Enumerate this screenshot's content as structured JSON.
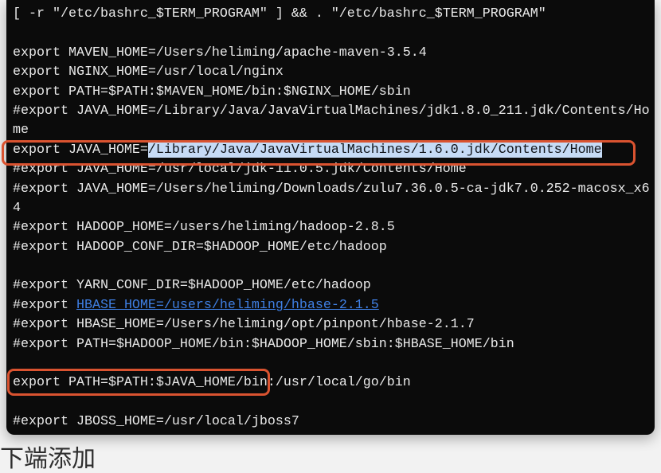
{
  "terminal": {
    "lines": [
      "[ -r \"/etc/bashrc_$TERM_PROGRAM\" ] && . \"/etc/bashrc_$TERM_PROGRAM\"",
      "export MAVEN_HOME=/Users/heliming/apache-maven-3.5.4",
      "export NGINX_HOME=/usr/local/nginx",
      "export PATH=$PATH:$MAVEN_HOME/bin:$NGINX_HOME/sbin",
      "#export JAVA_HOME=/Library/Java/JavaVirtualMachines/jdk1.8.0_211.jdk/Contents/Ho",
      "me",
      {
        "prefix": "export JAVA_HOME=",
        "selected": "/Library/Java/JavaVirtualMachines/1.6.0.jdk/Contents/Home"
      },
      "#export JAVA_HOME=/usr/local/jdk-11.0.5.jdk/Contents/Home",
      "#export JAVA_HOME=/Users/heliming/Downloads/zulu7.36.0.5-ca-jdk7.0.252-macosx_x6",
      "4",
      "#export HADOOP_HOME=/users/heliming/hadoop-2.8.5",
      "#export HADOOP_CONF_DIR=$HADOOP_HOME/etc/hadoop",
      "#export YARN_CONF_DIR=$HADOOP_HOME/etc/hadoop",
      {
        "prefix": "#export ",
        "link": "HBASE_HOME=/users/heliming/hbase-2.1.5"
      },
      "#export HBASE_HOME=/Users/heliming/opt/pinpont/hbase-2.1.7",
      "#export PATH=$HADOOP_HOME/bin:$HADOOP_HOME/sbin:$HBASE_HOME/bin",
      {
        "boxed": "export PATH=$PATH:$JAVA_HOME/bin",
        "rest": ":/usr/local/go/bin"
      },
      "#export JBOSS_HOME=/usr/local/jboss7"
    ]
  },
  "caption": "下端添加",
  "colors": {
    "page_background": "#f2f2f2",
    "terminal_background": "#0b0b0b",
    "text": "#e9e9e9",
    "selection_background": "#c6dbf6",
    "selection_text": "#12161c",
    "link": "#3f7fe3",
    "annotation_box": "#da5330",
    "caption_text": "#2e2e2e"
  }
}
